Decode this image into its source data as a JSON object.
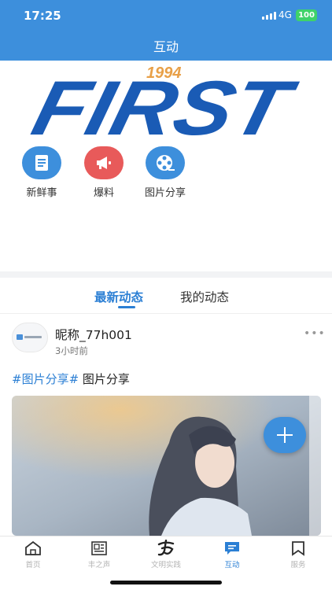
{
  "status_bar": {
    "time": "17:25",
    "network": "4G",
    "battery": "100"
  },
  "header": {
    "title": "互动"
  },
  "banner": {
    "text": "FIRST",
    "year": "1994"
  },
  "shortcuts": [
    {
      "label": "新鲜事",
      "icon": "document-icon",
      "color": "#3d8fdc"
    },
    {
      "label": "爆料",
      "icon": "megaphone-icon",
      "color": "#e85a5a"
    },
    {
      "label": "图片分享",
      "icon": "film-reel-icon",
      "color": "#3d8fdc"
    }
  ],
  "tabs": [
    {
      "label": "最新动态",
      "active": true
    },
    {
      "label": "我的动态",
      "active": false
    }
  ],
  "post": {
    "nickname": "昵称_77h001",
    "time": "3小时前",
    "tag": "#图片分享#",
    "text": " 图片分享"
  },
  "bottom_nav": [
    {
      "label": "首页",
      "icon": "home-icon",
      "active": false
    },
    {
      "label": "丰之声",
      "icon": "newspaper-icon",
      "active": false
    },
    {
      "label": "文明实践",
      "icon": "calligraphy-icon",
      "active": false
    },
    {
      "label": "互动",
      "icon": "chat-icon",
      "active": true
    },
    {
      "label": "服务",
      "icon": "bookmark-icon",
      "active": false
    }
  ],
  "colors": {
    "primary": "#3d8fdc",
    "accent_red": "#e85a5a",
    "battery": "#3fd26a"
  }
}
